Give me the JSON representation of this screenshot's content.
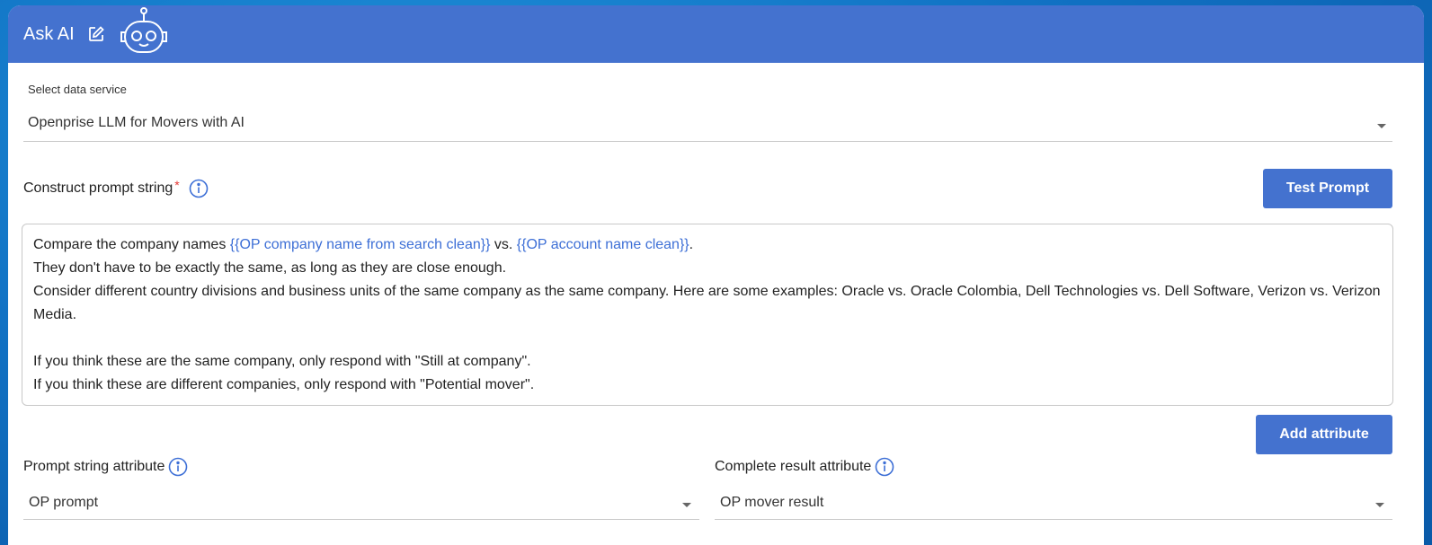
{
  "header": {
    "title": "Ask AI"
  },
  "data_service": {
    "label": "Select data service",
    "value": "Openprise LLM for Movers with AI"
  },
  "prompt": {
    "label": "Construct prompt string",
    "required_marker": "*",
    "test_button": "Test Prompt",
    "line1_a": "Compare the company names ",
    "line1_var1": "{{OP company name from search clean}}",
    "line1_b": " vs. ",
    "line1_var2": "{{OP account name clean}}",
    "line1_c": ".",
    "line2": "They don't have to be exactly the same, as long as they are close enough.",
    "line3": "Consider different country divisions and business units of the same company as the same company. Here are some examples: Oracle vs. Oracle Colombia, Dell Technologies vs. Dell Software, Verizon vs. Verizon Media.",
    "line4": "If you think these are the same company, only respond with \"Still at company\".",
    "line5": "If you think these are different companies, only respond with \"Potential mover\"."
  },
  "add_attribute_button": "Add attribute",
  "prompt_attribute": {
    "label": "Prompt string attribute",
    "value": "OP prompt"
  },
  "result_attribute": {
    "label": "Complete result attribute",
    "value": "OP mover result"
  },
  "colors": {
    "accent": "#4472cf",
    "variable": "#3d6fd6",
    "required": "#e53935"
  }
}
